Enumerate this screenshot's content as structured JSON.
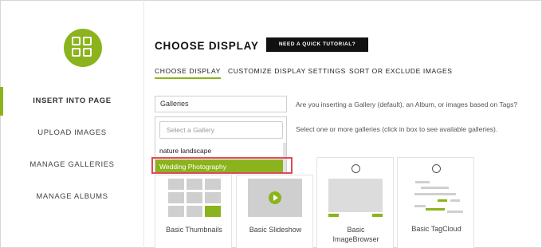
{
  "sidebar": {
    "items": [
      {
        "label": "INSERT INTO PAGE"
      },
      {
        "label": "UPLOAD IMAGES"
      },
      {
        "label": "MANAGE GALLERIES"
      },
      {
        "label": "MANAGE ALBUMS"
      }
    ]
  },
  "header": {
    "title": "CHOOSE DISPLAY",
    "tutorial_button": "NEED A QUICK TUTORIAL?"
  },
  "tabs": [
    {
      "label": "CHOOSE DISPLAY"
    },
    {
      "label": "CUSTOMIZE DISPLAY SETTINGS"
    },
    {
      "label": "SORT OR EXCLUDE IMAGES"
    }
  ],
  "form": {
    "type_value": "Galleries",
    "type_help": "Are you inserting a Gallery (default), an Album, or images based on Tags?",
    "gallery_placeholder": "Select a Gallery",
    "gallery_help": "Select one or more galleries (click in box to see available galleries).",
    "options": [
      "nature landscape",
      "Wedding Photography"
    ]
  },
  "displays": [
    {
      "label": "Basic Thumbnails"
    },
    {
      "label": "Basic Slideshow"
    },
    {
      "label": "Basic ImageBrowser"
    },
    {
      "label": "Basic TagCloud"
    }
  ],
  "colors": {
    "accent": "#8bb31d",
    "highlight": "#e2495a"
  }
}
